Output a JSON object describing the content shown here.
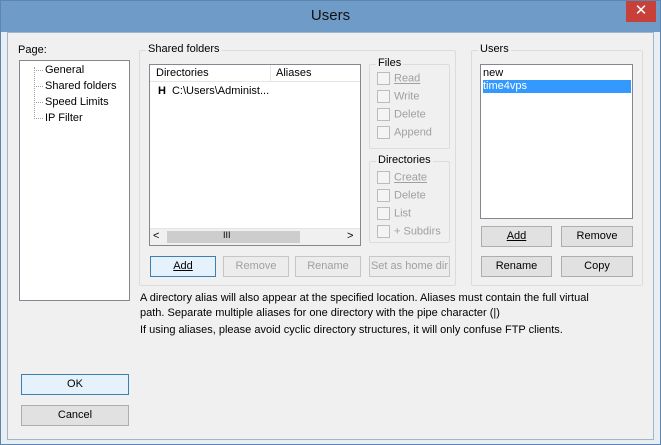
{
  "window": {
    "title": "Users",
    "close_glyph": "✕"
  },
  "page_panel": {
    "label": "Page:",
    "items": [
      {
        "label": "General"
      },
      {
        "label": "Shared folders"
      },
      {
        "label": "Speed Limits"
      },
      {
        "label": "IP Filter"
      }
    ],
    "selected": "Shared folders"
  },
  "shared_folders": {
    "label": "Shared folders",
    "columns": [
      "Directories",
      "Aliases"
    ],
    "rows": [
      {
        "marker": "H",
        "directory": "C:\\Users\\Administ...",
        "aliases": ""
      }
    ],
    "scroll_left": "<",
    "scroll_right": ">",
    "scroll_thumb": "III",
    "buttons": {
      "add": "Add",
      "remove": "Remove",
      "rename": "Rename",
      "set_home": "Set as home dir"
    }
  },
  "files": {
    "label": "Files",
    "options": [
      "Read",
      "Write",
      "Delete",
      "Append"
    ]
  },
  "directories": {
    "label": "Directories",
    "options": [
      "Create",
      "Delete",
      "List",
      "+ Subdirs"
    ]
  },
  "users": {
    "label": "Users",
    "items": [
      "new",
      "time4vps"
    ],
    "selected": "time4vps",
    "buttons": {
      "add": "Add",
      "remove": "Remove",
      "rename": "Rename",
      "copy": "Copy"
    }
  },
  "info": {
    "line1": "A directory alias will also appear at the specified location. Aliases must contain the full virtual",
    "line2": "path. Separate multiple aliases for one directory with the pipe character (|)",
    "line3": "If using aliases, please avoid cyclic directory structures, it will only confuse FTP clients."
  },
  "dialog_buttons": {
    "ok": "OK",
    "cancel": "Cancel"
  },
  "colors": {
    "selection": "#3399ff",
    "titlebar": "#6f9bc9",
    "close": "#c7403a"
  }
}
